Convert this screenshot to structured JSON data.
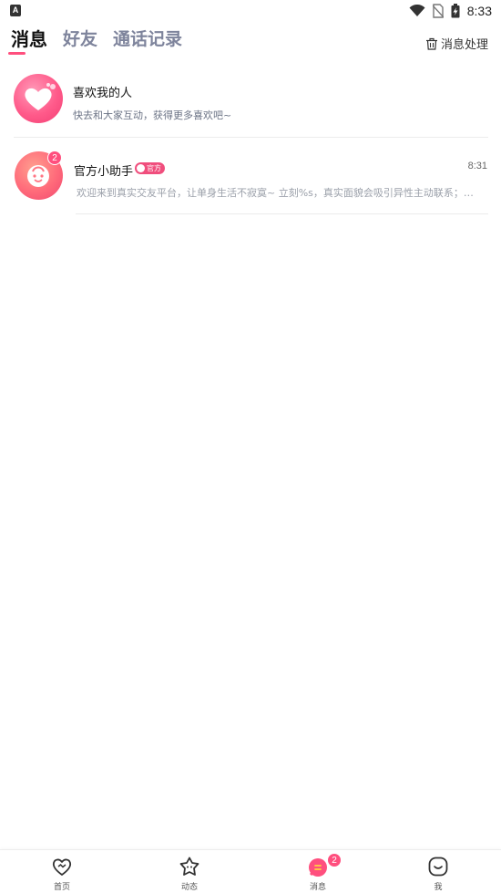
{
  "status_bar": {
    "left_icon": "a-notification-icon",
    "time": "8:33",
    "icons": [
      "wifi-icon",
      "no-sim-icon",
      "battery-charging-icon"
    ]
  },
  "header": {
    "tabs": [
      {
        "label": "消息",
        "active": true
      },
      {
        "label": "好友",
        "active": false
      },
      {
        "label": "通话记录",
        "active": false
      }
    ],
    "action_label": "消息处理",
    "action_icon": "trash-icon"
  },
  "list": [
    {
      "title": "喜欢我的人",
      "subtitle": "快去和大家互动，获得更多喜欢吧~",
      "avatar_icon": "heart-icon"
    },
    {
      "title": "官方小助手",
      "tag": "官方",
      "time": "8:31",
      "badge": "2",
      "preview": "欢迎来到真实交友平台，让单身生活不寂寞~ 立刻%s，真实面貌会吸引异性主动联系；完...",
      "avatar_icon": "smiley-face-icon"
    }
  ],
  "bottom_nav": [
    {
      "label": "首页",
      "icon": "home-heart-icon"
    },
    {
      "label": "动态",
      "icon": "star-face-icon"
    },
    {
      "label": "消息",
      "icon": "message-icon",
      "badge": "2",
      "active": true
    },
    {
      "label": "我",
      "icon": "profile-face-icon"
    }
  ],
  "colors": {
    "accent": "#ff4f7e",
    "tab_inactive": "#7e849c",
    "subtitle": "#6b7385",
    "preview": "#9ba0aa"
  }
}
